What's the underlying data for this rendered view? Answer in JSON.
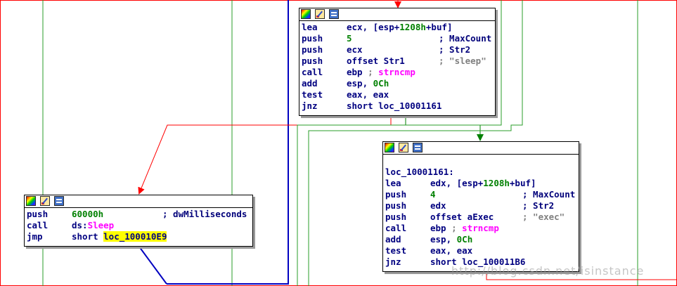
{
  "colors": {
    "true_edge": "#008000",
    "false_edge": "#ff0000",
    "unconditional_edge": "#0000c0",
    "border_red": "#ff0000"
  },
  "blocks": [
    {
      "id": "block-compare-sleep",
      "icons": [
        "graph-colors-icon",
        "edit-icon",
        "code-view-icon"
      ],
      "lines": [
        {
          "mn": "lea",
          "op_parts": [
            {
              "t": "ecx, [esp+"
            },
            {
              "t": "1208h",
              "c": "num"
            },
            {
              "t": "+buf]"
            }
          ]
        },
        {
          "mn": "push",
          "op_parts": [
            {
              "t": "5",
              "c": "num"
            }
          ],
          "comment": "; MaxCount"
        },
        {
          "mn": "push",
          "op_parts": [
            {
              "t": "ecx"
            }
          ],
          "comment": "; Str2"
        },
        {
          "mn": "push",
          "op_parts": [
            {
              "t": "offset Str1"
            }
          ],
          "comment": "; \"sleep\"",
          "comment_gray": true
        },
        {
          "mn": "call",
          "op_parts": [
            {
              "t": "ebp "
            },
            {
              "t": "; ",
              "c": "gray"
            },
            {
              "t": "strncmp",
              "c": "fn"
            }
          ]
        },
        {
          "mn": "add",
          "op_parts": [
            {
              "t": "esp, "
            },
            {
              "t": "0Ch",
              "c": "num"
            }
          ]
        },
        {
          "mn": "test",
          "op_parts": [
            {
              "t": "eax, eax"
            }
          ]
        },
        {
          "mn": "jnz",
          "op_parts": [
            {
              "t": "short loc_10001161"
            }
          ]
        }
      ]
    },
    {
      "id": "block-compare-exec",
      "icons": [
        "graph-colors-icon",
        "edit-icon",
        "code-view-icon"
      ],
      "lines": [
        {
          "mn": "",
          "op_parts": []
        },
        {
          "mn": "loc_10001161:",
          "op_parts": []
        },
        {
          "mn": "lea",
          "op_parts": [
            {
              "t": "edx, [esp+"
            },
            {
              "t": "1208h",
              "c": "num"
            },
            {
              "t": "+buf]"
            }
          ]
        },
        {
          "mn": "push",
          "op_parts": [
            {
              "t": "4",
              "c": "num"
            }
          ],
          "comment": "; MaxCount"
        },
        {
          "mn": "push",
          "op_parts": [
            {
              "t": "edx"
            }
          ],
          "comment": "; Str2"
        },
        {
          "mn": "push",
          "op_parts": [
            {
              "t": "offset aExec"
            }
          ],
          "comment": "; \"exec\"",
          "comment_gray": true
        },
        {
          "mn": "call",
          "op_parts": [
            {
              "t": "ebp "
            },
            {
              "t": "; ",
              "c": "gray"
            },
            {
              "t": "strncmp",
              "c": "fn"
            }
          ]
        },
        {
          "mn": "add",
          "op_parts": [
            {
              "t": "esp, "
            },
            {
              "t": "0Ch",
              "c": "num"
            }
          ]
        },
        {
          "mn": "test",
          "op_parts": [
            {
              "t": "eax, eax"
            }
          ]
        },
        {
          "mn": "jnz",
          "op_parts": [
            {
              "t": "short loc_100011B6"
            }
          ]
        }
      ]
    },
    {
      "id": "block-sleep-call",
      "icons": [
        "graph-colors-icon",
        "edit-icon",
        "code-view-icon"
      ],
      "lines": [
        {
          "mn": "push",
          "op_parts": [
            {
              "t": "60000h",
              "c": "num"
            }
          ],
          "comment": "; dwMilliseconds"
        },
        {
          "mn": "call",
          "op_parts": [
            {
              "t": "ds:"
            },
            {
              "t": "Sleep",
              "c": "fn"
            }
          ]
        },
        {
          "mn": "jmp",
          "op_parts": [
            {
              "t": "short "
            },
            {
              "t": "loc_100010E9",
              "c": "hl"
            }
          ]
        }
      ]
    }
  ],
  "watermark": "http://blog.csdn.net/isinstance"
}
